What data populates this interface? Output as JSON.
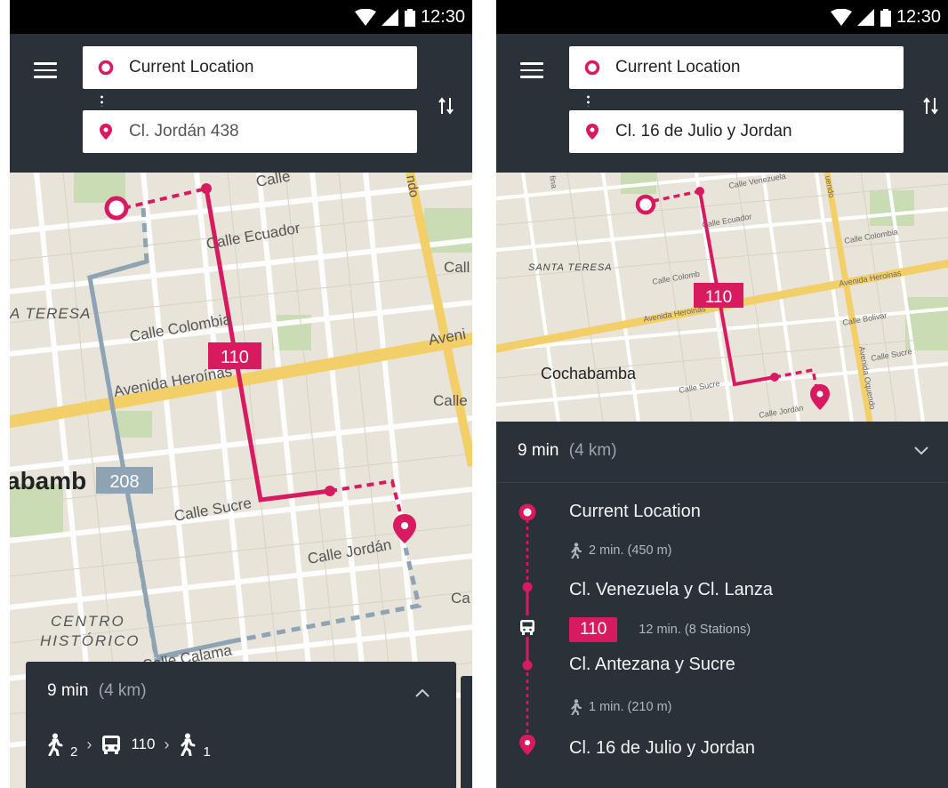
{
  "status_bar": {
    "time": "12:30"
  },
  "left_screen": {
    "origin": {
      "icon": "origin-circle-icon",
      "value": "Current Location"
    },
    "destination": {
      "icon": "pin-icon",
      "value": "Cl. Jordán 438"
    },
    "map_labels": {
      "calle_ecuador": "Calle Ecuador",
      "calle_colombia": "Calle Colombia",
      "avenida_heroinas": "Avenida Heroínas",
      "calle_sucre": "Calle Sucre",
      "calle_jordan": "Calle Jordán",
      "calle_calama": "Calle Calama",
      "teresa": "A TERESA",
      "centro": "CENTRO",
      "historico": "HISTÓRICO",
      "cochabamba_fragment": "abamb",
      "calle_top": "Calle",
      "avenida_right": "Aveni",
      "calle_right1": "Call",
      "calle_right2": "Calle",
      "ca_right": "Ca",
      "ndo": "ndo",
      "ezza": "e nza"
    },
    "route_badges": {
      "primary": "110",
      "alternative": "208"
    },
    "summary": {
      "duration": "9 min",
      "distance": "(4 km)",
      "walk1_sub": "2",
      "bus_number": "110",
      "walk2_sub": "1",
      "expand_icon": "chevron-up-icon"
    }
  },
  "right_screen": {
    "origin": {
      "icon": "origin-circle-icon",
      "value": "Current Location"
    },
    "destination": {
      "icon": "pin-icon",
      "value": "Cl. 16 de Julio y Jordan"
    },
    "map_labels": {
      "santa_teresa": "SANTA TERESA",
      "cochabamba": "Cochabamba",
      "calle_venezuela": "Calle Venezuela",
      "calle_ecuador": "Calle Ecuador",
      "calle_colombia_a": "Calle Colomb",
      "calle_colombia_b": "Calle Colombia",
      "avenida_heroinas_a": "Avenida Heroinas",
      "avenida_heroinas_b": "Avenida Heroinas",
      "calle_bolivar": "Calle Bolivar",
      "calle_sucre_a": "Calle Sucre",
      "calle_sucre_b": "Calle Sucre",
      "calle_jordan": "Calle Jordán",
      "avenida_oquendo": "Avenida Oquendo",
      "fina": "fina",
      "uendo": "uendo"
    },
    "route_badge": "110",
    "panel": {
      "duration": "9 min",
      "distance": "(4 km)",
      "collapse_icon": "chevron-down-icon",
      "stops": [
        "Current Location",
        "Cl. Venezuela y Cl. Lanza",
        "Cl. Antezana y Sucre",
        "Cl. 16 de Julio y Jordan"
      ],
      "walk1": "2 min. (450 m)",
      "bus_badge": "110",
      "bus_info": "12 min. (8 Stations)",
      "walk2": "1 min. (210 m)"
    }
  },
  "colors": {
    "app_bar": "#2a3138",
    "accent": "#d81b60",
    "alt_route": "#8ea3b3",
    "map_bg": "#e9e4da",
    "avenue": "#f3cf6a"
  }
}
